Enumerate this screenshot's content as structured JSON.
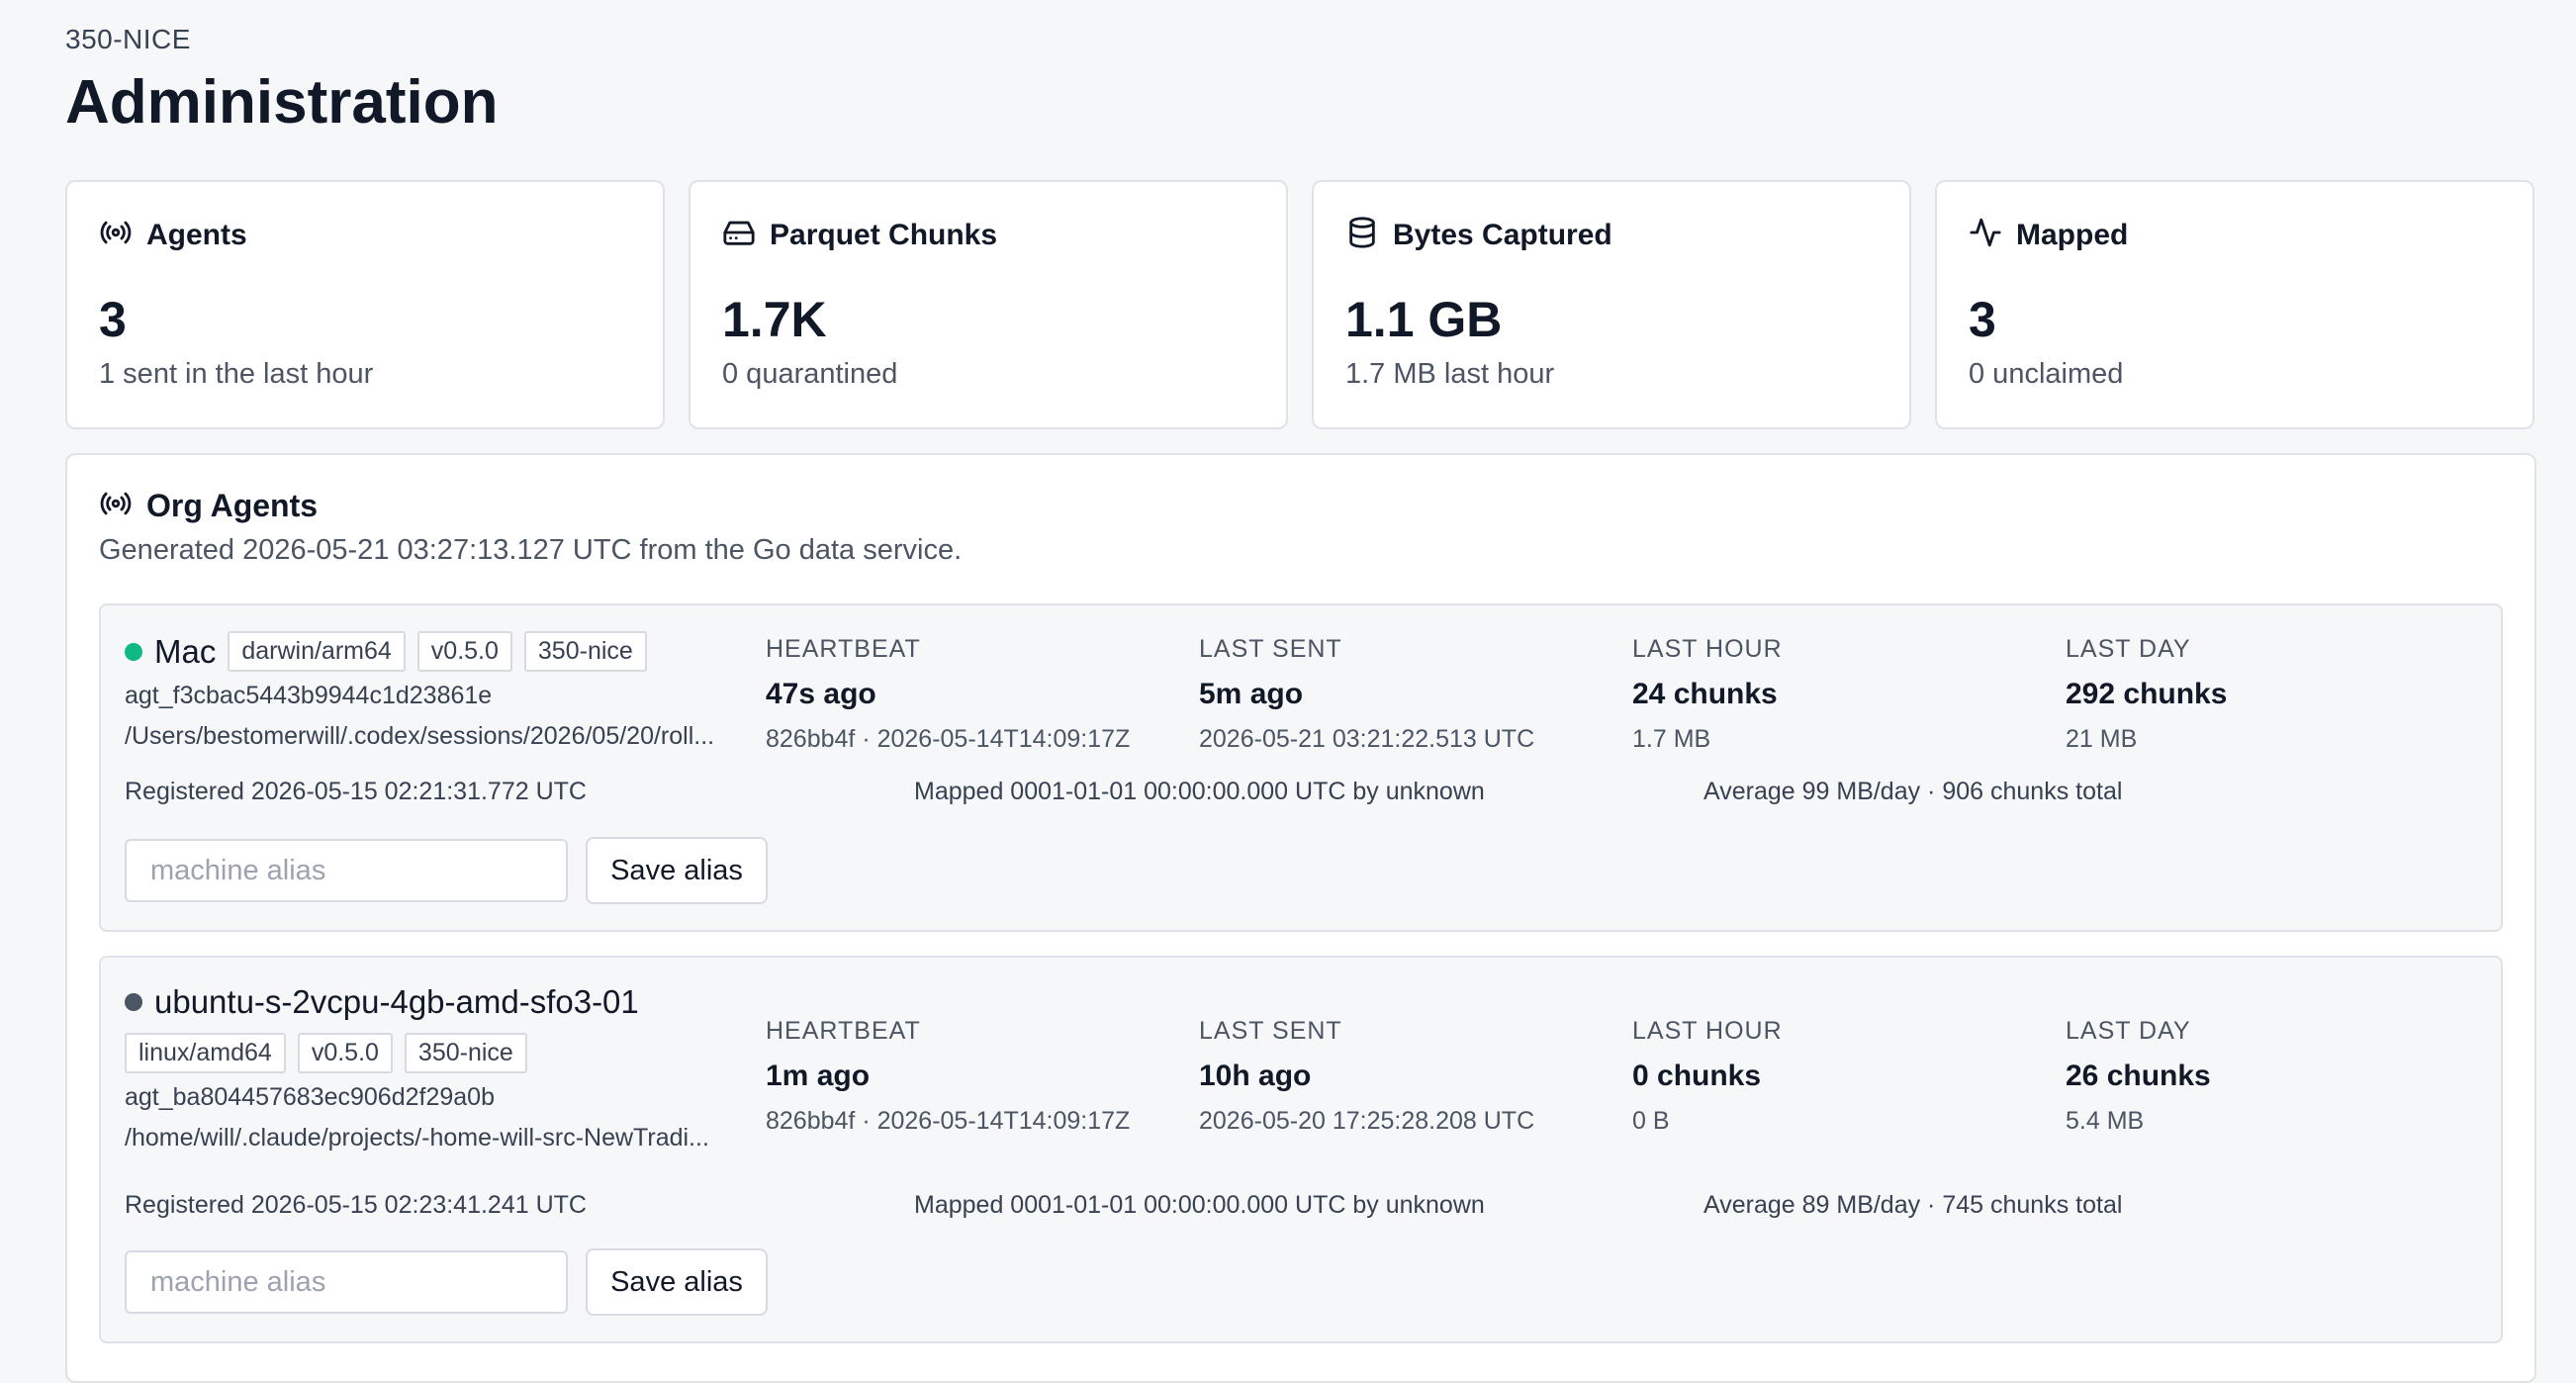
{
  "header": {
    "org": "350-NICE",
    "title": "Administration"
  },
  "stats": [
    {
      "icon": "broadcast-icon",
      "label": "Agents",
      "value": "3",
      "sub": "1 sent in the last hour"
    },
    {
      "icon": "hard-drive-icon",
      "label": "Parquet Chunks",
      "value": "1.7K",
      "sub": "0 quarantined"
    },
    {
      "icon": "database-icon",
      "label": "Bytes Captured",
      "value": "1.1 GB",
      "sub": "1.7 MB last hour"
    },
    {
      "icon": "activity-icon",
      "label": "Mapped",
      "value": "3",
      "sub": "0 unclaimed"
    }
  ],
  "org_agents": {
    "title": "Org Agents",
    "subtitle": "Generated 2026-05-21 03:27:13.127 UTC from the Go data service.",
    "metric_labels": {
      "heartbeat": "HEARTBEAT",
      "last_sent": "LAST SENT",
      "last_hour": "LAST HOUR",
      "last_day": "LAST DAY"
    },
    "alias_placeholder": "machine alias",
    "save_label": "Save alias",
    "agents": [
      {
        "status": "online",
        "status_color": "#10b981",
        "name": "Mac",
        "tags": [
          "darwin/arm64",
          "v0.5.0",
          "350-nice"
        ],
        "id": "agt_f3cbac5443b9944c1d23861e",
        "path": "/Users/bestomerwill/.codex/sessions/2026/05/20/roll...",
        "heartbeat": {
          "value": "47s ago",
          "sub": "826bb4f · 2026-05-14T14:09:17Z"
        },
        "last_sent": {
          "value": "5m ago",
          "sub": "2026-05-21 03:21:22.513 UTC"
        },
        "last_hour": {
          "value": "24 chunks",
          "sub": "1.7 MB"
        },
        "last_day": {
          "value": "292 chunks",
          "sub": "21 MB"
        },
        "registered": "Registered 2026-05-15 02:21:31.772 UTC",
        "mapped": "Mapped 0001-01-01 00:00:00.000 UTC by unknown",
        "average": "Average 99 MB/day · 906 chunks total"
      },
      {
        "status": "idle",
        "status_color": "#4b5563",
        "name": "ubuntu-s-2vcpu-4gb-amd-sfo3-01",
        "tags": [
          "linux/amd64",
          "v0.5.0",
          "350-nice"
        ],
        "id": "agt_ba804457683ec906d2f29a0b",
        "path": "/home/will/.claude/projects/-home-will-src-NewTradi...",
        "heartbeat": {
          "value": "1m ago",
          "sub": "826bb4f · 2026-05-14T14:09:17Z"
        },
        "last_sent": {
          "value": "10h ago",
          "sub": "2026-05-20 17:25:28.208 UTC"
        },
        "last_hour": {
          "value": "0 chunks",
          "sub": "0 B"
        },
        "last_day": {
          "value": "26 chunks",
          "sub": "5.4 MB"
        },
        "registered": "Registered 2026-05-15 02:23:41.241 UTC",
        "mapped": "Mapped 0001-01-01 00:00:00.000 UTC by unknown",
        "average": "Average 89 MB/day · 745 chunks total"
      }
    ]
  }
}
